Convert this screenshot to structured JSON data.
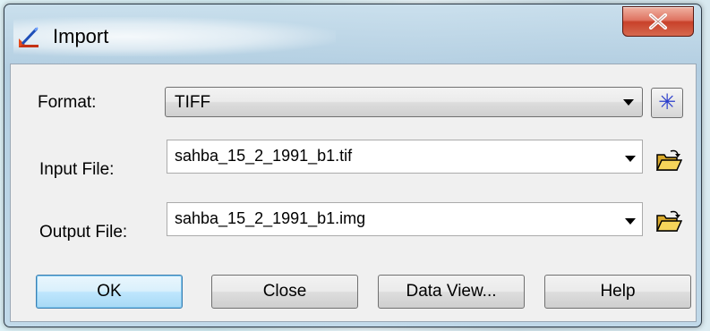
{
  "window": {
    "title": "Import",
    "close_glyph": "X"
  },
  "icons": {
    "app": "import-tool-icon",
    "close": "close-icon",
    "format_option": "asterisk-icon",
    "input_browse": "open-folder-icon",
    "output_browse": "open-folder-icon"
  },
  "form": {
    "format": {
      "label": "Format:",
      "value": "TIFF"
    },
    "input_file": {
      "label": "Input File:",
      "value": "sahba_15_2_1991_b1.tif"
    },
    "output_file": {
      "label": "Output File:",
      "value": "sahba_15_2_1991_b1.img"
    },
    "options_glyph": "✳"
  },
  "buttons": {
    "ok": "OK",
    "close": "Close",
    "data_view": "Data View...",
    "help": "Help"
  },
  "colors": {
    "close_button": "#c8412a",
    "default_button_border": "#3c7fb1",
    "asterisk": "#2a3dcc"
  }
}
